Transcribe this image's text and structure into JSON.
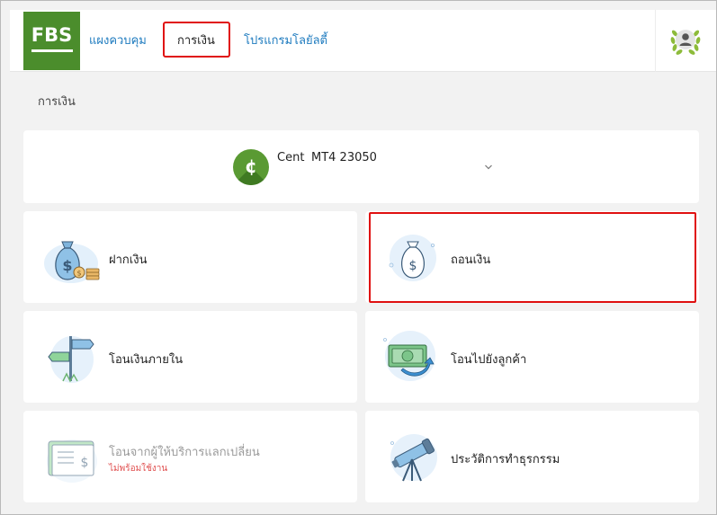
{
  "header": {
    "logo_text": "FBS",
    "nav": {
      "dashboard": "แผงควบคุม",
      "finances": "การเงิน",
      "loyalty": "โปรแกรมโลยัลตี้"
    }
  },
  "breadcrumb": "การเงิน",
  "account": {
    "currency_symbol": "¢",
    "type": "Cent",
    "number": "MT4 23050"
  },
  "tiles": [
    {
      "label": "ฝากเงิน",
      "icon": "money-bag-coins-icon"
    },
    {
      "label": "ถอนเงิน",
      "icon": "money-bag-icon"
    },
    {
      "label": "โอนเงินภายใน",
      "icon": "signpost-icon"
    },
    {
      "label": "โอนไปยังลูกค้า",
      "icon": "banknote-transfer-icon"
    },
    {
      "label": "โอนจากผู้ให้บริการแลกเปลี่ยน",
      "note": "ไม่พร้อมใช้งาน",
      "icon": "wallet-book-icon"
    },
    {
      "label": "ประวัติการทำธุรกรรม",
      "icon": "telescope-icon"
    }
  ],
  "colors": {
    "brand_green": "#4b8d2c",
    "link_blue": "#1e7bbf",
    "highlight_red": "#e01010",
    "unavailable_red": "#e05050"
  }
}
